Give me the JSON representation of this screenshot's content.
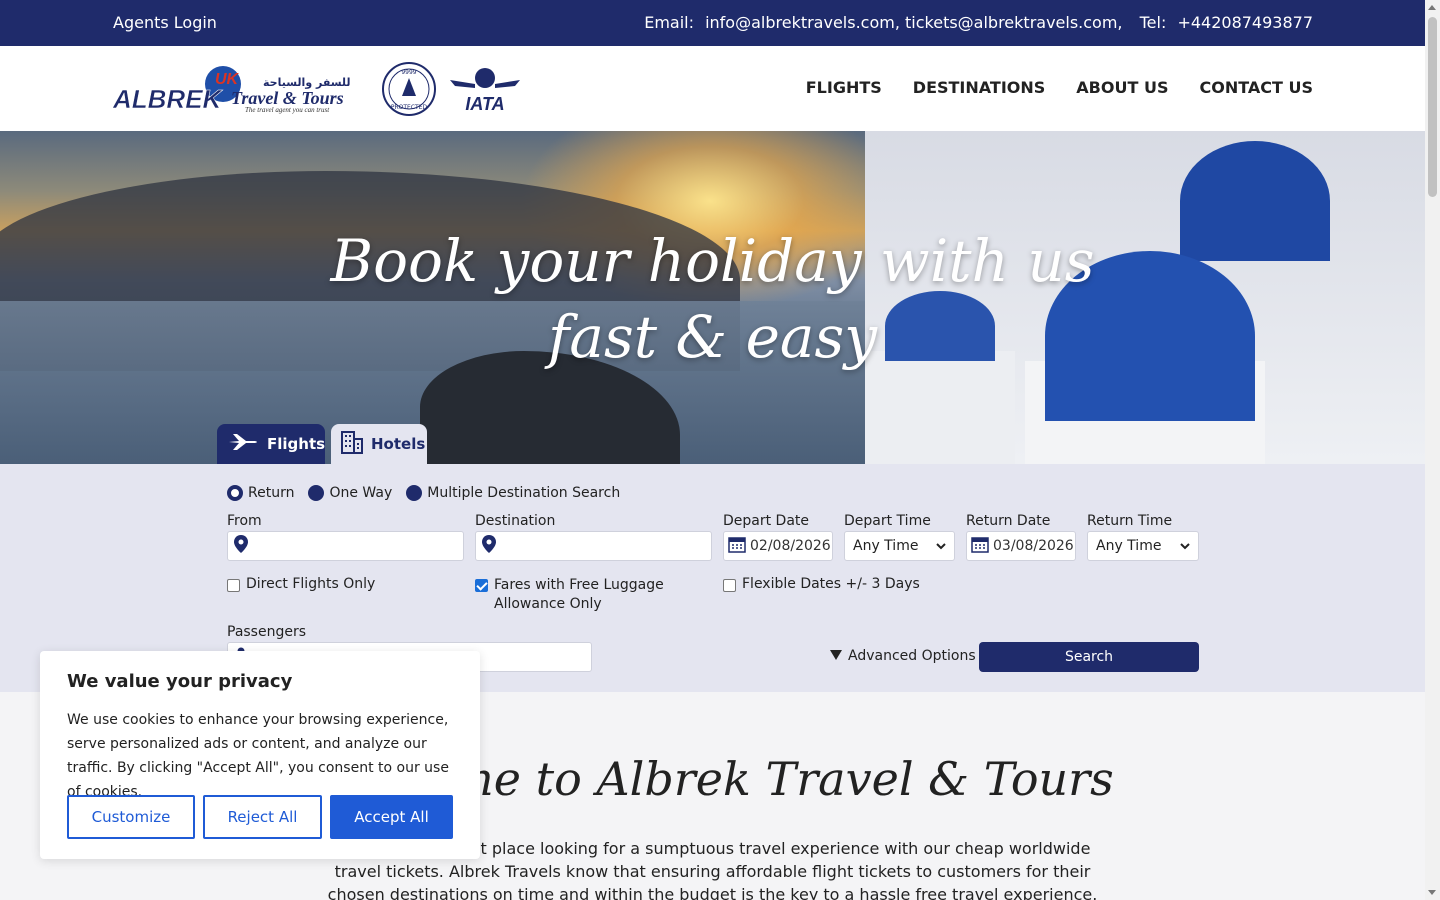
{
  "topbar": {
    "agents_login": "Agents Login",
    "email_label": "Email:",
    "email_value": "info@albrektravels.com, tickets@albrektravels.com,",
    "tel_label": "Tel:",
    "tel_value": "+442087493877"
  },
  "header": {
    "logo_text": "ALBREK Travel & Tours",
    "logo_tagline": "The travel agent you can trust",
    "atol_text": "ATOL PROTECTED 9999",
    "iata_text": "IATA",
    "nav": [
      "FLIGHTS",
      "DESTINATIONS",
      "ABOUT US",
      "CONTACT US"
    ]
  },
  "hero": {
    "headline_line1": "Book your holiday with us",
    "headline_line2": "fast & easy"
  },
  "tabs": {
    "flights": "Flights",
    "hotels": "Hotels"
  },
  "search": {
    "trip_types": [
      "Return",
      "One Way",
      "Multiple Destination Search"
    ],
    "selected_trip_type": "Return",
    "from_label": "From",
    "destination_label": "Destination",
    "depart_date_label": "Depart Date",
    "depart_date_value": "02/08/2026",
    "depart_time_label": "Depart Time",
    "depart_time_value": "Any Time",
    "return_date_label": "Return Date",
    "return_date_value": "03/08/2026",
    "return_time_label": "Return Time",
    "return_time_value": "Any Time",
    "direct_flights": "Direct Flights Only",
    "free_luggage": "Fares with Free Luggage Allowance Only",
    "flexible_dates": "Flexible Dates +/- 3 Days",
    "passengers_label": "Passengers",
    "advanced_options": "Advanced Options",
    "search_button": "Search"
  },
  "welcome": {
    "title": "Welcome to Albrek Travel & Tours",
    "text": "You are in the right place looking for a sumptuous travel experience with our cheap worldwide travel tickets. Albrek Travels know that ensuring affordable flight tickets to customers for their chosen destinations on time and within the budget is the key to a hassle free travel experience."
  },
  "cookie": {
    "title": "We value your privacy",
    "text": "We use cookies to enhance your browsing experience, serve personalized ads or content, and analyze our traffic. By clicking \"Accept All\", you consent to our use of cookies.",
    "customize": "Customize",
    "reject": "Reject All",
    "accept": "Accept All"
  },
  "colors": {
    "brand_navy": "#1f2b6b",
    "accept_blue": "#1f5bd6",
    "search_bg": "#e4e5f0"
  }
}
